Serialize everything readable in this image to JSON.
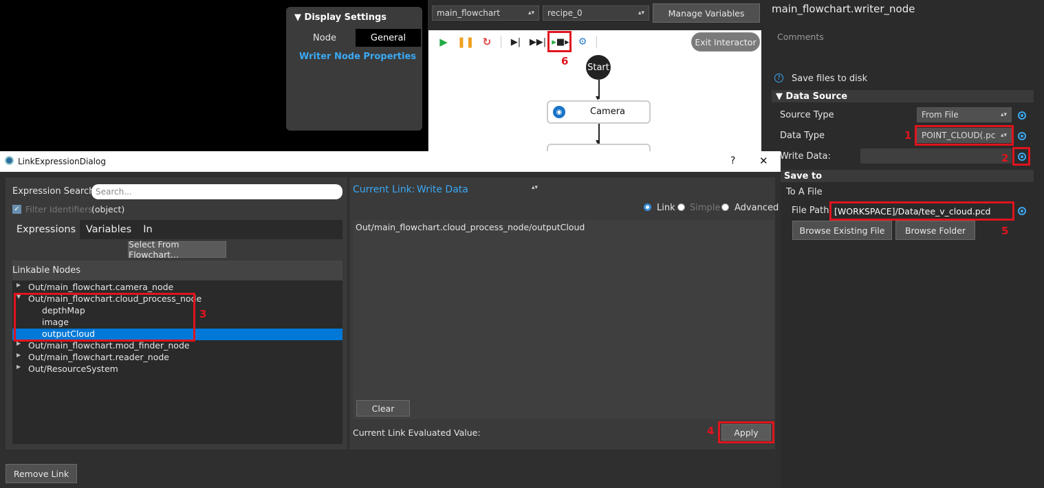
{
  "display_settings": {
    "title": "Display Settings",
    "tabs": [
      "Node",
      "General"
    ],
    "link": "Writer Node Properties"
  },
  "toolbar": {
    "flowchart_select": "main_flowchart",
    "recipe_select": "recipe_0",
    "manage_variables": "Manage Variables",
    "exit_interactor": "Exit Interactor"
  },
  "flowchart": {
    "start_label": "Start",
    "camera_label": "Camera"
  },
  "right_panel": {
    "title": "main_flowchart.writer_node",
    "comments": "Comments",
    "save_files": "Save files to disk",
    "data_source_header": "Data Source",
    "source_type_label": "Source Type",
    "source_type_value": "From File",
    "data_type_label": "Data Type",
    "data_type_value": "POINT_CLOUD(.pc",
    "write_data_label": "Write Data:",
    "save_to_header": "Save to",
    "to_a_file": "To A File",
    "file_path_label": "File Path:",
    "file_path_value": "[WORKSPACE]/Data/tee_v_cloud.pcd",
    "browse_file": "Browse Existing File",
    "browse_folder": "Browse Folder"
  },
  "dialog": {
    "title": "LinkExpressionDialog",
    "help": "?",
    "close": "✕",
    "expression_search_label": "Expression Search:",
    "search_placeholder": "Search...",
    "filter_identifiers": "Filter Identifiers",
    "object_label": "(object)",
    "tabs": [
      "Expressions",
      "Variables",
      "In"
    ],
    "select_from_flowchart": "Select From Flowchart...",
    "linkable_nodes": "Linkable Nodes",
    "tree": [
      {
        "label": "Out/main_flowchart.camera_node"
      },
      {
        "label": "Out/main_flowchart.cloud_process_node"
      },
      {
        "label": "depthMap"
      },
      {
        "label": "image"
      },
      {
        "label": "outputCloud"
      },
      {
        "label": "Out/main_flowchart.mod_finder_node"
      },
      {
        "label": "Out/main_flowchart.reader_node"
      },
      {
        "label": "Out/ResourceSystem"
      }
    ],
    "current_link_label": "Current Link:",
    "current_link_value": "Write Data",
    "mode_link": "Link",
    "mode_simple": "Simple",
    "mode_advanced": "Advanced",
    "expression_text": "Out/main_flowchart.cloud_process_node/outputCloud",
    "clear": "Clear",
    "evaluated_value_label": "Current Link Evaluated Value:",
    "apply": "Apply",
    "remove_link": "Remove Link"
  },
  "annotations": [
    "1",
    "2",
    "3",
    "4",
    "5",
    "6"
  ],
  "colors": {
    "accent": "#3aa9f4",
    "highlight": "#e0141e",
    "selection": "#0078d7"
  }
}
